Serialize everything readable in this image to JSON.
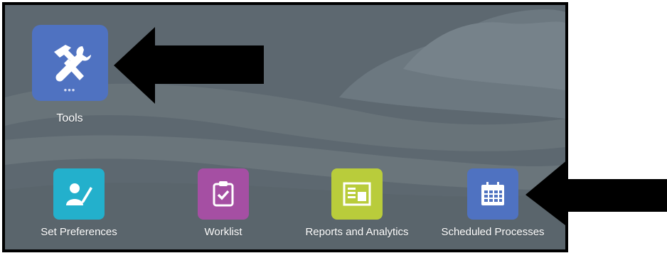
{
  "tiles": {
    "tools": {
      "label": "Tools",
      "color": "#4f72c1",
      "icon": "hammer-wrench-icon",
      "more_glyph": "•••"
    },
    "set_preferences": {
      "label": "Set Preferences",
      "color": "#23b0cc",
      "icon": "user-edit-icon"
    },
    "worklist": {
      "label": "Worklist",
      "color": "#a54fa3",
      "icon": "clipboard-check-icon"
    },
    "reports": {
      "label": "Reports and Analytics",
      "color": "#b9cc3b",
      "icon": "report-chart-icon"
    },
    "scheduled": {
      "label": "Scheduled Processes",
      "color": "#4f72c1",
      "icon": "calendar-icon"
    }
  },
  "colors": {
    "background": "#5f6a73",
    "arrow": "#000000",
    "frame": "#000000"
  },
  "annotations": [
    {
      "name": "arrow-to-tools",
      "direction": "left"
    },
    {
      "name": "arrow-to-scheduled-processes",
      "direction": "left"
    }
  ]
}
